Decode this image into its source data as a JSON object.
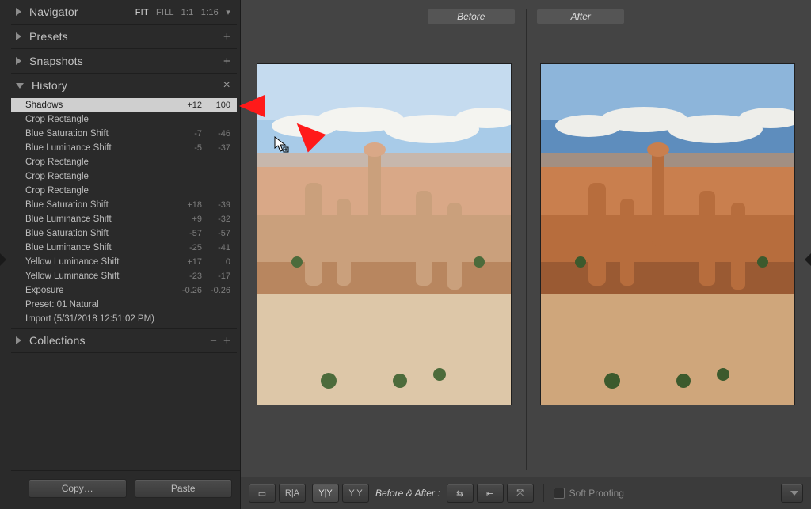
{
  "panels": {
    "navigator": {
      "title": "Navigator",
      "zoom": {
        "fit": "FIT",
        "fill": "FILL",
        "one": "1:1",
        "ratio": "1:16"
      }
    },
    "presets": {
      "title": "Presets"
    },
    "snapshots": {
      "title": "Snapshots"
    },
    "history": {
      "title": "History"
    },
    "collections": {
      "title": "Collections"
    }
  },
  "history_items": [
    {
      "name": "Shadows",
      "v1": "+12",
      "v2": "100",
      "selected": true
    },
    {
      "name": "Crop Rectangle",
      "v1": "",
      "v2": ""
    },
    {
      "name": "Blue Saturation Shift",
      "v1": "-7",
      "v2": "-46"
    },
    {
      "name": "Blue Luminance Shift",
      "v1": "-5",
      "v2": "-37"
    },
    {
      "name": "Crop Rectangle",
      "v1": "",
      "v2": ""
    },
    {
      "name": "Crop Rectangle",
      "v1": "",
      "v2": ""
    },
    {
      "name": "Crop Rectangle",
      "v1": "",
      "v2": ""
    },
    {
      "name": "Blue Saturation Shift",
      "v1": "+18",
      "v2": "-39"
    },
    {
      "name": "Blue Luminance Shift",
      "v1": "+9",
      "v2": "-32"
    },
    {
      "name": "Blue Saturation Shift",
      "v1": "-57",
      "v2": "-57"
    },
    {
      "name": "Blue Luminance Shift",
      "v1": "-25",
      "v2": "-41"
    },
    {
      "name": "Yellow Luminance Shift",
      "v1": "+17",
      "v2": "0"
    },
    {
      "name": "Yellow Luminance Shift",
      "v1": "-23",
      "v2": "-17"
    },
    {
      "name": "Exposure",
      "v1": "-0.26",
      "v2": "-0.26"
    },
    {
      "name": "Preset: 01 Natural",
      "v1": "",
      "v2": ""
    },
    {
      "name": "Import (5/31/2018 12:51:02 PM)",
      "v1": "",
      "v2": ""
    }
  ],
  "buttons": {
    "copy": "Copy…",
    "paste": "Paste"
  },
  "compare": {
    "before": "Before",
    "after": "After"
  },
  "toolbar": {
    "loupe_icon": "▭",
    "ra_icon": "R|A",
    "yy_icon": "Y|Y",
    "yy2_icon": "Y Y",
    "ba_label": "Before & After :",
    "swap_icon": "⇆",
    "copytoleft_icon": "⇤",
    "copytoright_icon": "⤧",
    "soft_proof": "Soft Proofing"
  },
  "tools": {
    "plus": "+",
    "minus": "−",
    "close": "×",
    "caret": "▾"
  }
}
